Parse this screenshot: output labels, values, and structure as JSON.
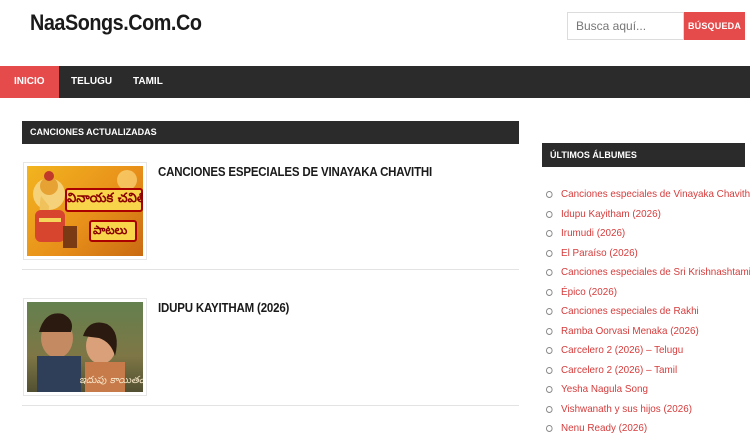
{
  "header": {
    "site_title": "NaaSongs.Com.Co",
    "search_placeholder": "Busca aquí...",
    "search_button": "BÚSQUEDA"
  },
  "nav": {
    "items": [
      "INICIO",
      "TELUGU",
      "TAMIL"
    ],
    "active": "INICIO"
  },
  "main": {
    "section_title": "CANCIONES ACTUALIZADAS",
    "posts": [
      {
        "title": "CANCIONES ESPECIALES DE VINAYAKA CHAVITHI",
        "thumb_text_line1": "వినాయక చవితి",
        "thumb_text_line2": "పాటలు"
      },
      {
        "title": "IDUPU KAYITHAM (2026)",
        "thumb_text_line1": "ఇదుపు కాయితం"
      }
    ]
  },
  "sidebar": {
    "title": "ÚLTIMOS ÁLBUMES",
    "items": [
      "Canciones especiales de Vinayaka Chavithi",
      "Idupu Kayitham (2026)",
      "Irumudi (2026)",
      "El Paraíso (2026)",
      "Canciones especiales de Sri Krishnashtami",
      "Épico (2026)",
      "Canciones especiales de Rakhi",
      "Ramba Oorvasi Menaka (2026)",
      "Carcelero 2 (2026) – Telugu",
      "Carcelero 2 (2026) – Tamil",
      "Yesha Nagula Song",
      "Vishwanath y sus hijos (2026)",
      "Nenu Ready (2026)"
    ]
  },
  "colors": {
    "accent": "#e54b4b",
    "dark_bar": "#2b2b2b",
    "link": "#d63b3b"
  }
}
